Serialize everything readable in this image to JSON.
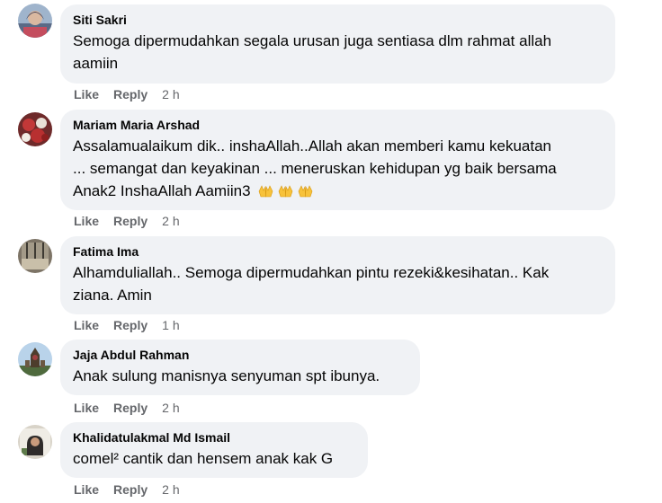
{
  "actions": {
    "like": "Like",
    "reply": "Reply"
  },
  "comments": [
    {
      "author": "Siti Sakri",
      "lines": [
        "Semoga dipermudahkan segala urusan juga sentiasa dlm rahmat allah",
        "aamiin"
      ],
      "time": "2 h"
    },
    {
      "author": "Mariam Maria Arshad",
      "lines": [
        "Assalamualaikum dik.. inshaAllah..Allah akan memberi kamu kekuatan",
        "... semangat dan keyakinan ... meneruskan kehidupan yg baik bersama",
        "Anak2 InshaAllah Aamiin3"
      ],
      "emoji": [
        "raising-hands-icon",
        "raising-hands-icon",
        "raising-hands-icon"
      ],
      "time": "2 h"
    },
    {
      "author": "Fatima Ima",
      "lines": [
        "Alhamduliallah.. Semoga dipermudahkan pintu rezeki&kesihatan.. Kak",
        "ziana. Amin"
      ],
      "time": "1 h"
    },
    {
      "author": "Jaja Abdul Rahman",
      "lines": [
        "Anak sulung manisnya senyuman spt ibunya."
      ],
      "time": "2 h"
    },
    {
      "author": "Khalidatulakmal Md Ismail",
      "lines": [
        "comel² cantik dan hensem anak kak G"
      ],
      "time": "2 h"
    }
  ]
}
